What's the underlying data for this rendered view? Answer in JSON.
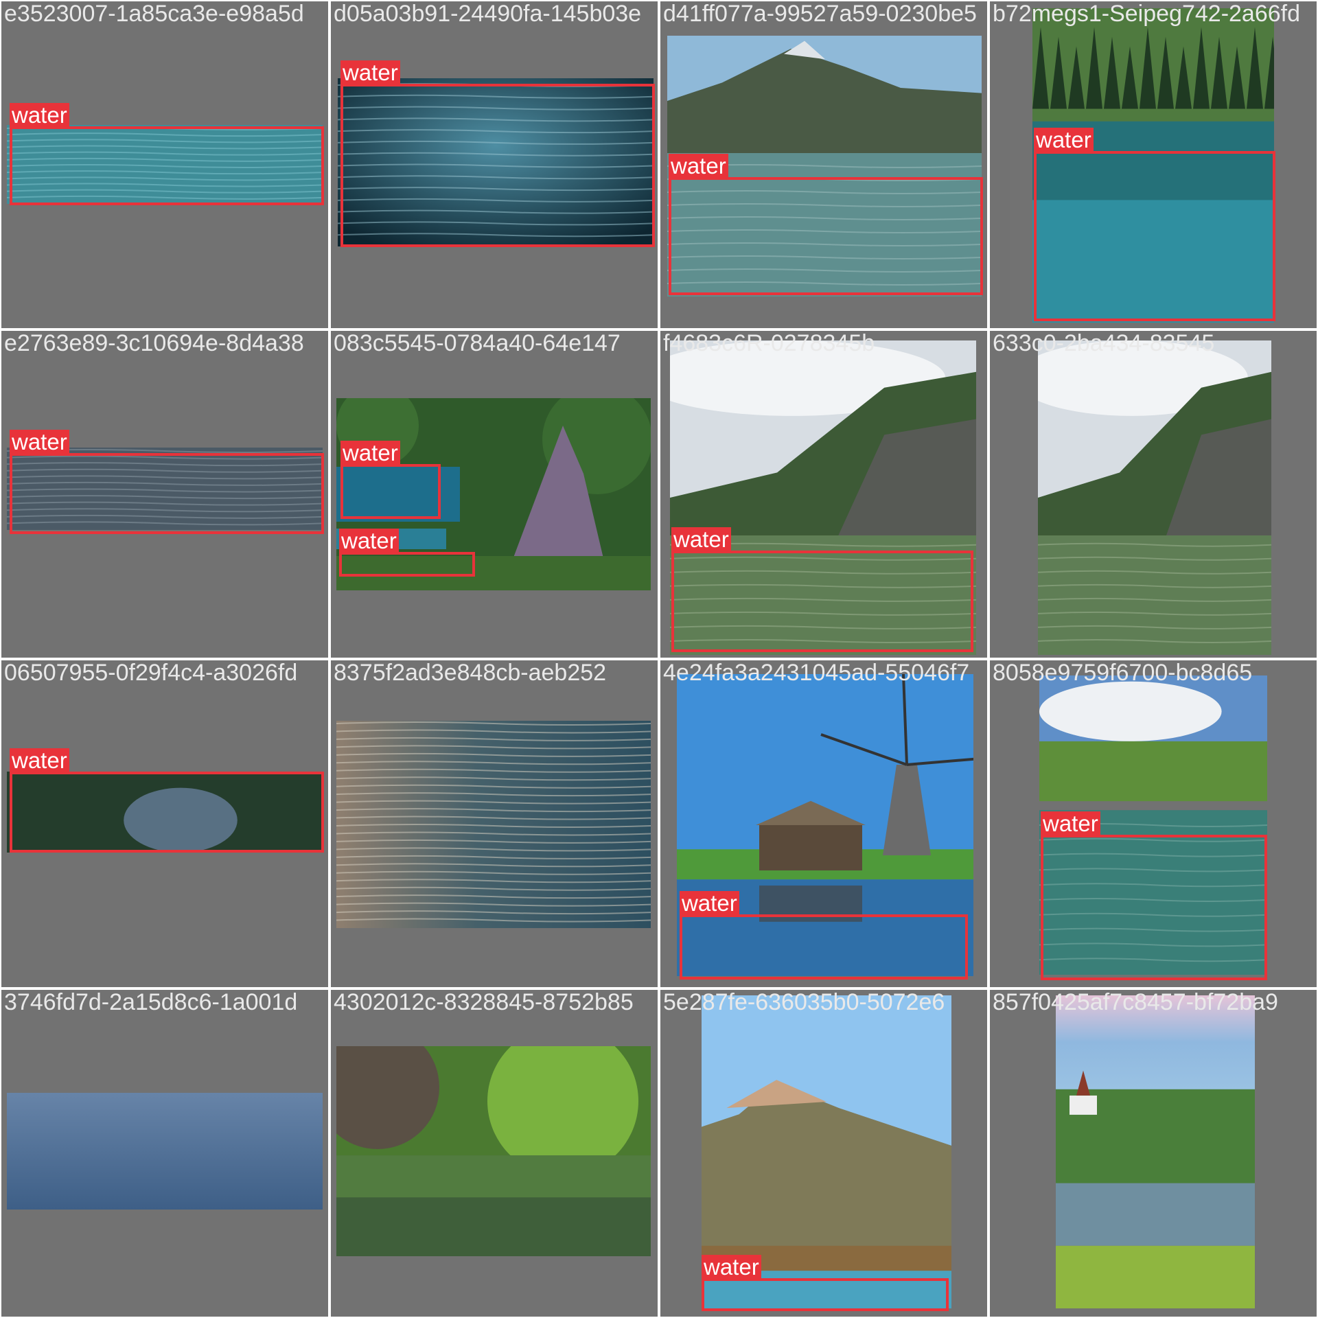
{
  "colors": {
    "background": "#727272",
    "box": "#e8333a",
    "label_text": "#ffffff",
    "filename_text": "#e9e9e9"
  },
  "cells": [
    {
      "filename": "e3523007-1a85ca3e-e98a5d",
      "scene": "water-ripples",
      "detections": [
        {
          "label": "water"
        }
      ]
    },
    {
      "filename": "d05a03b91-24490fa-145b03e",
      "scene": "dark-water",
      "detections": [
        {
          "label": "water"
        }
      ]
    },
    {
      "filename": "d41ff077a-99527a59-0230be5",
      "scene": "mountain-lake",
      "detections": [
        {
          "label": "water"
        }
      ]
    },
    {
      "filename": "b72megs1-Seipeg742-2a66fd",
      "scene": "forest-lake",
      "detections": [
        {
          "label": "water"
        }
      ]
    },
    {
      "filename": "e2763e89-3c10694e-8d4a38",
      "scene": "grey-water",
      "detections": [
        {
          "label": "water"
        }
      ]
    },
    {
      "filename": "083c5545-0784a40-64e147",
      "scene": "jungle-pools",
      "detections": [
        {
          "label": "water"
        },
        {
          "label": "water"
        }
      ]
    },
    {
      "filename": "f4683c6R-0278345b",
      "scene": "cloudy-mountain-lake",
      "detections": [
        {
          "label": "water"
        }
      ]
    },
    {
      "filename": "633c0-2ba434-83545",
      "scene": "cloudy-mountain-nolabel",
      "detections": []
    },
    {
      "filename": "06507955-0f29f4c4-a3026fd",
      "scene": "green-water",
      "detections": [
        {
          "label": "water"
        }
      ]
    },
    {
      "filename": "8375f2ad3e848cb-aeb252",
      "scene": "shimmer-water",
      "detections": []
    },
    {
      "filename": "4e24fa3a2431045ad-55046f7",
      "scene": "windmill",
      "detections": [
        {
          "label": "water"
        }
      ]
    },
    {
      "filename": "8058e9759f6700-bc8d65",
      "scene": "pond-trees",
      "detections": [
        {
          "label": "water"
        }
      ]
    },
    {
      "filename": "3746fd7d-2a15d8c6-1a001d",
      "scene": "blue-calm",
      "detections": []
    },
    {
      "filename": "4302012c-8328845-8752b85",
      "scene": "green-river",
      "detections": []
    },
    {
      "filename": "5e287fe-636035b0-5072e6",
      "scene": "hill-lake",
      "detections": [
        {
          "label": "water"
        }
      ]
    },
    {
      "filename": "857f0425af7c8457-bf72ba9",
      "scene": "village-lake",
      "detections": []
    }
  ]
}
